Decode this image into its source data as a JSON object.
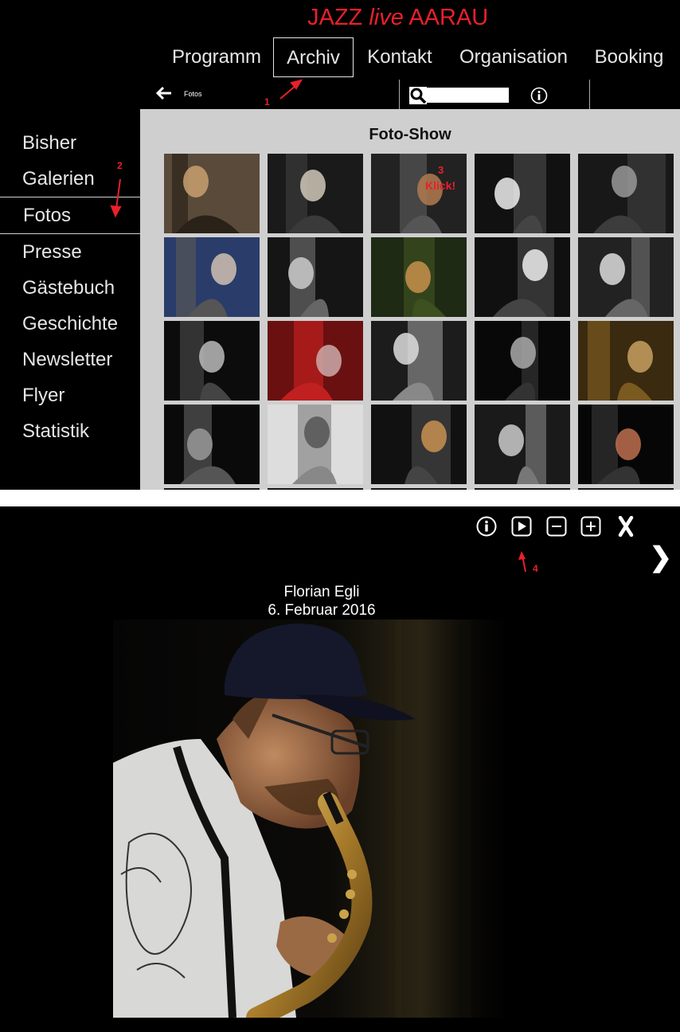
{
  "site": {
    "title_prefix": "JAZZ",
    "title_live": "live",
    "title_suffix": "AARAU"
  },
  "topnav": {
    "items": [
      "Programm",
      "Archiv",
      "Kontakt",
      "Organisation",
      "Booking"
    ],
    "active": "Archiv"
  },
  "subbar": {
    "breadcrumb": "Fotos",
    "search_placeholder": ""
  },
  "sidebar": {
    "items": [
      "Bisher",
      "Galerien",
      "Fotos",
      "Presse",
      "Gästebuch",
      "Geschichte",
      "Newsletter",
      "Flyer",
      "Statistik"
    ],
    "active": "Fotos"
  },
  "gallery": {
    "title": "Foto-Show",
    "rows": 4,
    "cols": 5
  },
  "annotations": {
    "a1": "1",
    "a2": "2",
    "a3": "3",
    "a3_text": "Klick!",
    "a4": "4"
  },
  "viewer": {
    "controls": [
      "info-icon",
      "play-icon",
      "zoom-out-icon",
      "zoom-in-icon",
      "close-icon"
    ],
    "next": "❯",
    "caption_name": "Florian Egli",
    "caption_date": "6. Februar 2016"
  },
  "colors": {
    "accent_red": "#e8202a",
    "panel_grey": "#cfcfcf",
    "background": "#000000"
  }
}
